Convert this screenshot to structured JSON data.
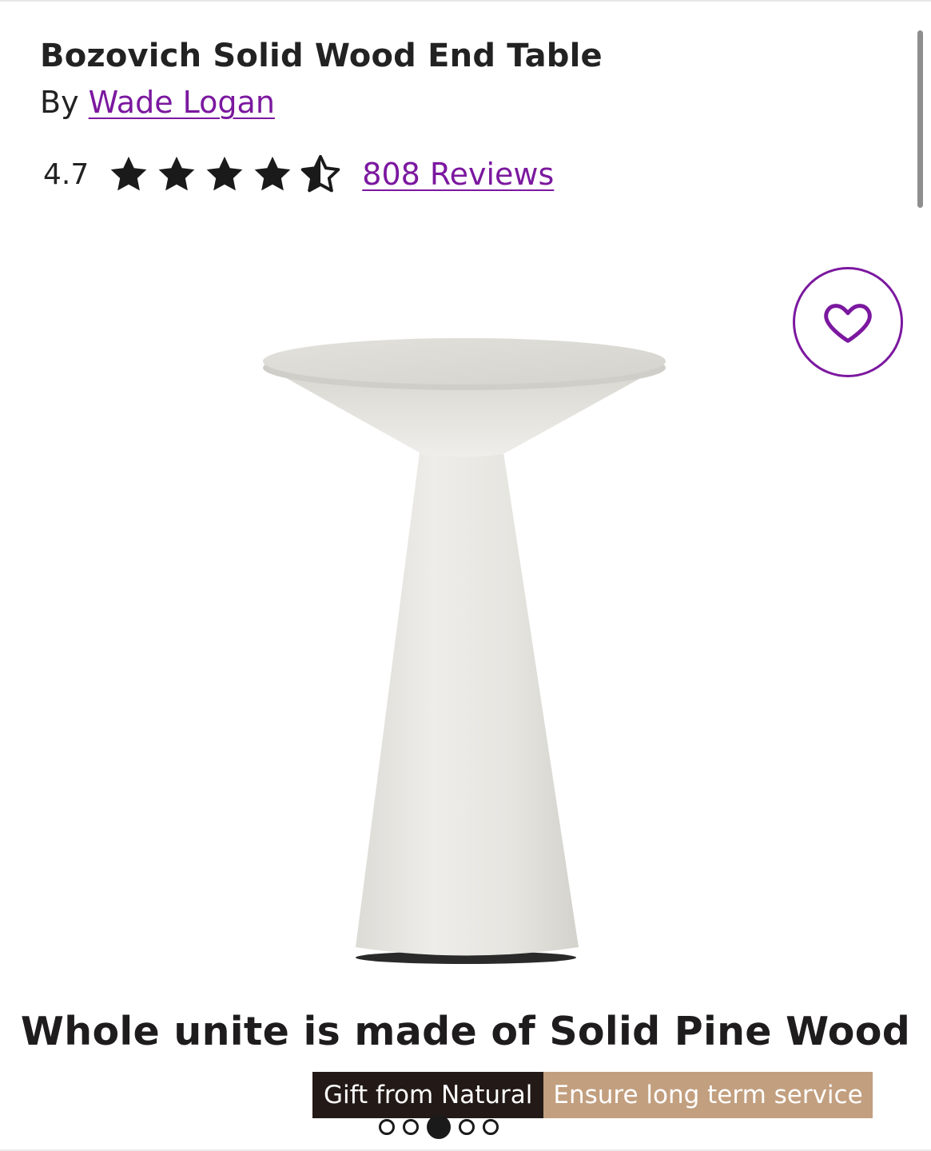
{
  "product": {
    "title": "Bozovich Solid Wood End Table",
    "by_prefix": "By",
    "brand": "Wade Logan",
    "rating": "4.7",
    "stars": 4.5,
    "reviews_label": "808 Reviews"
  },
  "wishlist": {
    "icon": "heart-outline-icon"
  },
  "image": {
    "headline": "Whole unite is made of Solid Pine Wood",
    "tag_left": "Gift from Natural",
    "tag_right": "Ensure long term service"
  },
  "carousel": {
    "count": 5,
    "active_index": 2
  },
  "colors": {
    "accent": "#7b189f",
    "text": "#222222",
    "strip_dark": "#231a17",
    "strip_tan": "#c29f7f"
  }
}
